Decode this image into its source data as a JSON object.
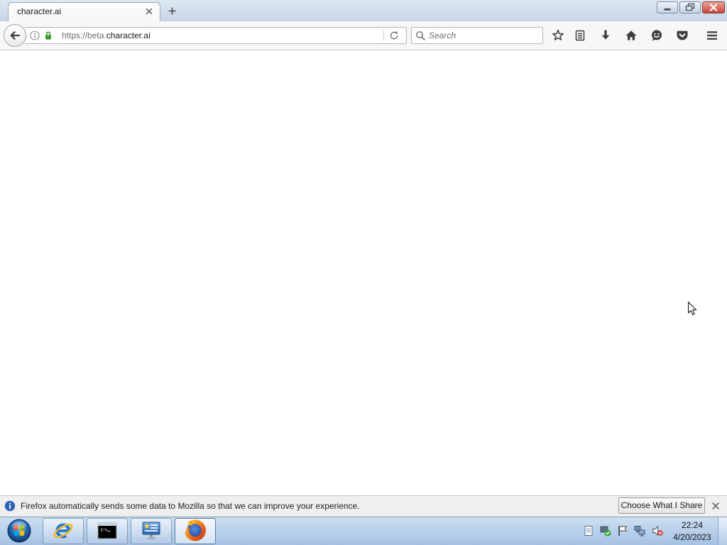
{
  "browser": {
    "tabs": [
      {
        "title": "character.ai",
        "active": true
      }
    ],
    "tab_icons": [
      "tab-close-icon",
      "new-tab-icon"
    ],
    "window_controls": [
      "minimize-icon",
      "restore-icon",
      "close-icon"
    ],
    "address_bar": {
      "url_prefix": "https://beta.",
      "url_host": "character.ai",
      "icons": [
        "site-info-icon",
        "lock-icon",
        "reload-icon"
      ]
    },
    "search": {
      "placeholder": "Search",
      "icon": "search-icon"
    },
    "toolbar_icons": [
      "back-icon",
      "bookmark-star-icon",
      "bookmarks-menu-icon",
      "downloads-icon",
      "home-icon",
      "hello-icon",
      "pocket-icon",
      "menu-icon"
    ],
    "notification": {
      "icon": "info-icon",
      "message": "Firefox automatically sends some data to Mozilla so that we can improve your experience.",
      "button_label": "Choose What I Share",
      "close_icon": "close-icon"
    }
  },
  "taskbar": {
    "start_icon": "windows-start-icon",
    "pinned_apps": [
      {
        "icon": "internet-explorer-icon",
        "active": false
      },
      {
        "icon": "command-prompt-icon",
        "active": false
      },
      {
        "icon": "server-manager-icon",
        "active": false
      },
      {
        "icon": "firefox-icon",
        "active": true
      }
    ],
    "tray_icons": [
      "notes-icon",
      "security-check-icon",
      "action-center-flag-icon",
      "network-icon",
      "volume-muted-icon"
    ],
    "clock": {
      "time": "22:24",
      "date": "4/20/2023"
    },
    "show_desktop_icon": "show-desktop-icon"
  },
  "screen": {
    "cursor_icon": "mouse-cursor-icon"
  },
  "colors": {
    "lock_green": "#3d9b2f",
    "close_button_red": "#c9463d",
    "notification_info_blue": "#2f62b2",
    "taskbar_top": "#cddff2",
    "taskbar_bottom": "#a4c1e3"
  }
}
